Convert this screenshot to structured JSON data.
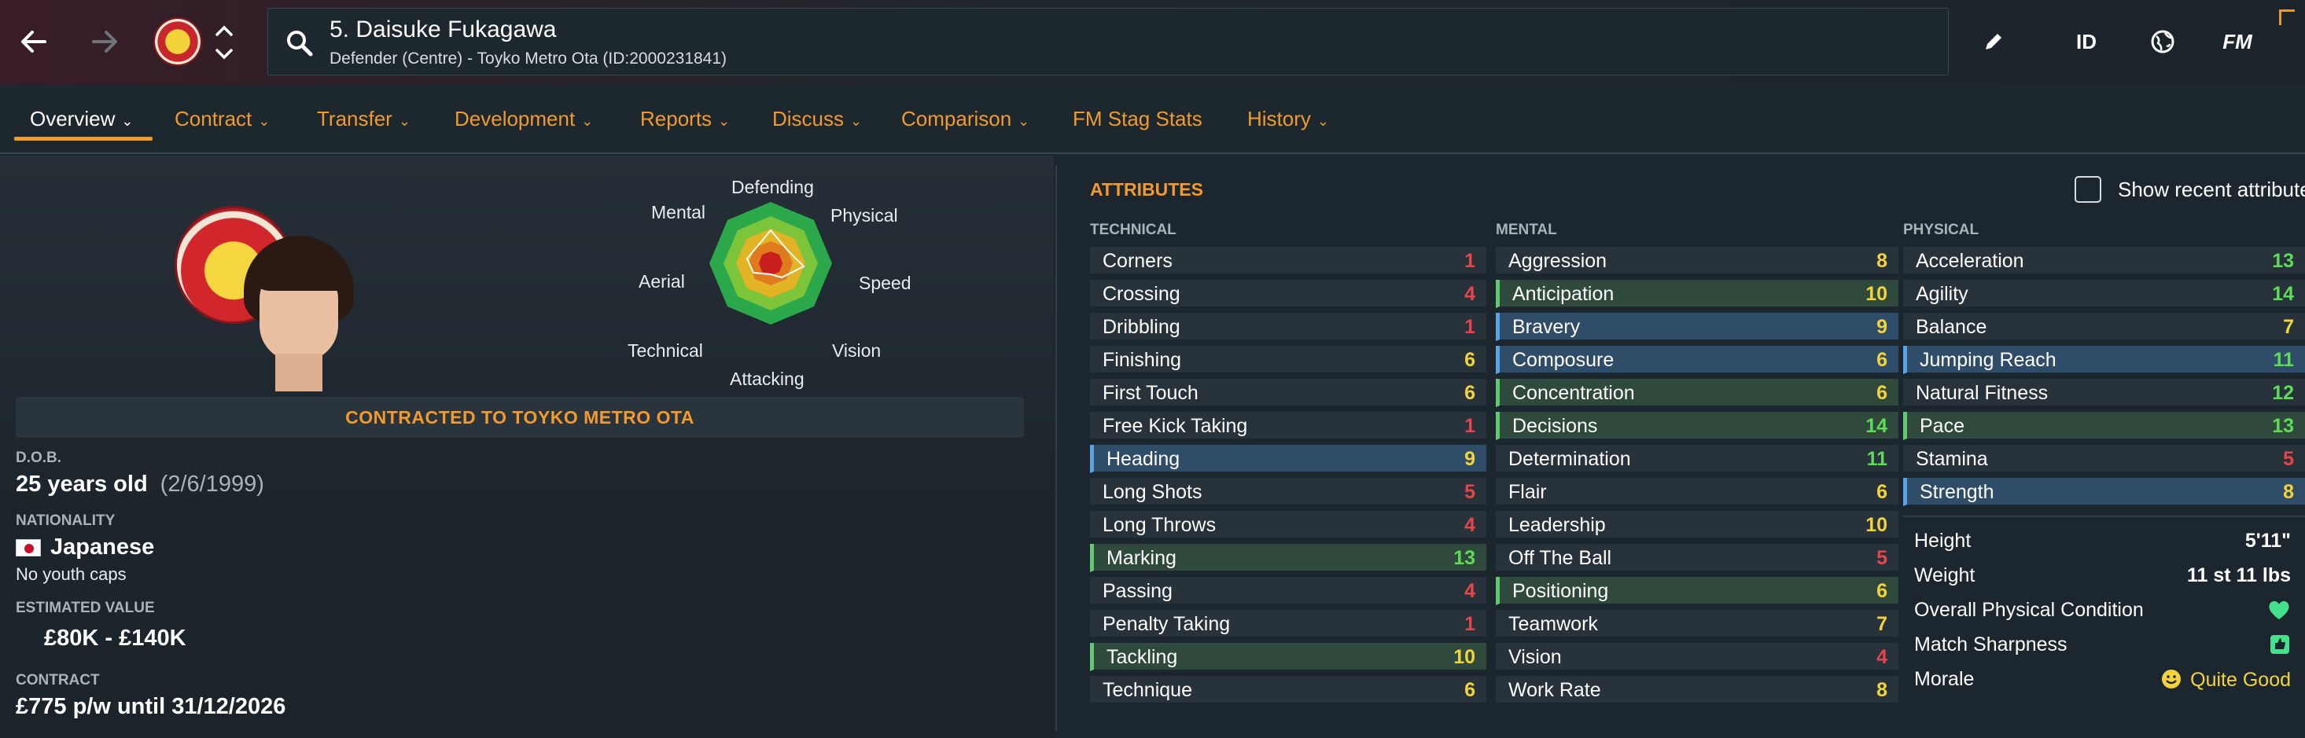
{
  "header": {
    "player_name": "5. Daisuke Fukagawa",
    "player_sub": "Defender (Centre) - Toyko Metro Ota (ID:2000231841)",
    "tools": {
      "id": "ID",
      "fm": "FM"
    }
  },
  "tabs": [
    {
      "label": "Overview",
      "chevron": "⌄"
    },
    {
      "label": "Contract",
      "chevron": "⌄"
    },
    {
      "label": "Transfer",
      "chevron": "⌄"
    },
    {
      "label": "Development",
      "chevron": "⌄"
    },
    {
      "label": "Reports",
      "chevron": "⌄"
    },
    {
      "label": "Discuss",
      "chevron": "⌄"
    },
    {
      "label": "Comparison",
      "chevron": "⌄"
    },
    {
      "label": "FM Stag Stats",
      "chevron": ""
    },
    {
      "label": "History",
      "chevron": "⌄"
    }
  ],
  "radar": {
    "labels": {
      "defending": "Defending",
      "physical": "Physical",
      "speed": "Speed",
      "vision": "Vision",
      "attacking": "Attacking",
      "technical": "Technical",
      "aerial": "Aerial",
      "mental": "Mental"
    }
  },
  "profile": {
    "contract_banner": "CONTRACTED TO TOYKO METRO OTA",
    "dob_label": "D.O.B.",
    "age": "25 years old",
    "dob": "(2/6/1999)",
    "nationality_label": "NATIONALITY",
    "nationality": "Japanese",
    "youth_caps": "No youth caps",
    "value_label": "ESTIMATED VALUE",
    "value": "£80K - £140K",
    "contract_label": "CONTRACT",
    "contract": "£775 p/w until 31/12/2026"
  },
  "attributes": {
    "title": "ATTRIBUTES",
    "show_recent": "Show recent attributes",
    "technical_head": "TECHNICAL",
    "mental_head": "MENTAL",
    "physical_head": "PHYSICAL",
    "technical": [
      {
        "name": "Corners",
        "value": "1"
      },
      {
        "name": "Crossing",
        "value": "4"
      },
      {
        "name": "Dribbling",
        "value": "1"
      },
      {
        "name": "Finishing",
        "value": "6"
      },
      {
        "name": "First Touch",
        "value": "6"
      },
      {
        "name": "Free Kick Taking",
        "value": "1"
      },
      {
        "name": "Heading",
        "value": "9"
      },
      {
        "name": "Long Shots",
        "value": "5"
      },
      {
        "name": "Long Throws",
        "value": "4"
      },
      {
        "name": "Marking",
        "value": "13"
      },
      {
        "name": "Passing",
        "value": "4"
      },
      {
        "name": "Penalty Taking",
        "value": "1"
      },
      {
        "name": "Tackling",
        "value": "10"
      },
      {
        "name": "Technique",
        "value": "6"
      }
    ],
    "mental": [
      {
        "name": "Aggression",
        "value": "8"
      },
      {
        "name": "Anticipation",
        "value": "10"
      },
      {
        "name": "Bravery",
        "value": "9"
      },
      {
        "name": "Composure",
        "value": "6"
      },
      {
        "name": "Concentration",
        "value": "6"
      },
      {
        "name": "Decisions",
        "value": "14"
      },
      {
        "name": "Determination",
        "value": "11"
      },
      {
        "name": "Flair",
        "value": "6"
      },
      {
        "name": "Leadership",
        "value": "10"
      },
      {
        "name": "Off The Ball",
        "value": "5"
      },
      {
        "name": "Positioning",
        "value": "6"
      },
      {
        "name": "Teamwork",
        "value": "7"
      },
      {
        "name": "Vision",
        "value": "4"
      },
      {
        "name": "Work Rate",
        "value": "8"
      }
    ],
    "physical": [
      {
        "name": "Acceleration",
        "value": "13"
      },
      {
        "name": "Agility",
        "value": "14"
      },
      {
        "name": "Balance",
        "value": "7"
      },
      {
        "name": "Jumping Reach",
        "value": "11"
      },
      {
        "name": "Natural Fitness",
        "value": "12"
      },
      {
        "name": "Pace",
        "value": "13"
      },
      {
        "name": "Stamina",
        "value": "5"
      },
      {
        "name": "Strength",
        "value": "8"
      }
    ],
    "physical_info": [
      {
        "label": "Height",
        "value": "5'11\""
      },
      {
        "label": "Weight",
        "value": "11 st 11 lbs"
      },
      {
        "label": "Overall Physical Condition",
        "value": ""
      },
      {
        "label": "Match Sharpness",
        "value": ""
      },
      {
        "label": "Morale",
        "value": "Quite Good"
      }
    ]
  },
  "colors": {
    "accent": "#f29a2e",
    "value_red": "#e8454a",
    "value_orange": "#f08a2c",
    "value_yellow": "#f2d43a",
    "value_green": "#5fdc57",
    "highlight_blue": "#2f4d68",
    "highlight_green": "#2f4a3c"
  },
  "icons": [
    "back-arrow-icon",
    "forward-arrow-icon",
    "club-badge-icon",
    "switch-arrows-icon",
    "search-icon",
    "edit-pencil-icon",
    "globe-icon",
    "heart-icon",
    "thumbs-up-icon",
    "smiley-icon",
    "japan-flag-icon"
  ]
}
